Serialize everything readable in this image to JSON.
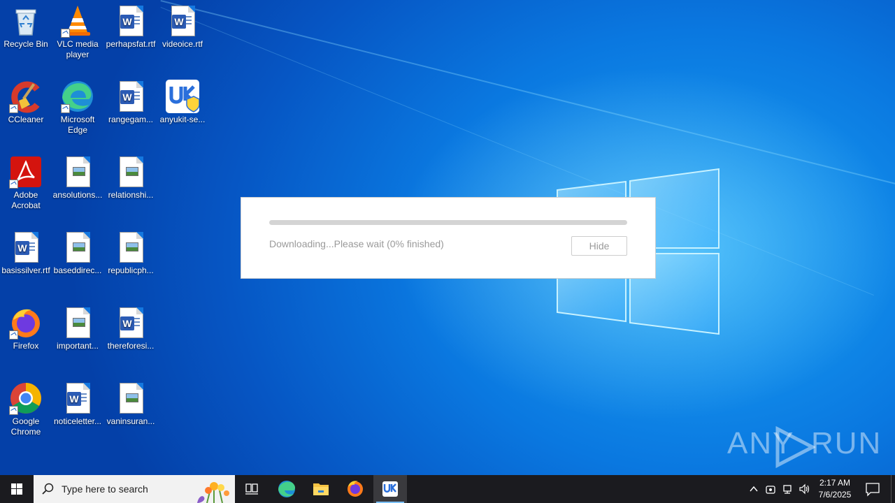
{
  "desktop": {
    "icons": [
      {
        "label": "Recycle Bin"
      },
      {
        "label": "VLC media player"
      },
      {
        "label": "perhapsfat.rtf"
      },
      {
        "label": "videoice.rtf"
      },
      {
        "label": "CCleaner"
      },
      {
        "label": "Microsoft Edge"
      },
      {
        "label": "rangegam..."
      },
      {
        "label": "anyukit-se..."
      },
      {
        "label": "Adobe Acrobat"
      },
      {
        "label": "ansolutions..."
      },
      {
        "label": "relationshi..."
      },
      {
        "label": "basissilver.rtf"
      },
      {
        "label": "baseddirec..."
      },
      {
        "label": "republicph..."
      },
      {
        "label": "Firefox"
      },
      {
        "label": "important..."
      },
      {
        "label": "thereforesi..."
      },
      {
        "label": "Google Chrome"
      },
      {
        "label": "noticeletter..."
      },
      {
        "label": "vaninsuran..."
      }
    ]
  },
  "dialog": {
    "status": "Downloading...Please wait (0% finished)",
    "progress_percent": 0,
    "hide_label": "Hide"
  },
  "watermark": {
    "left": "ANY",
    "right": "RUN"
  },
  "taskbar": {
    "search_placeholder": "Type here to search",
    "time": "2:17 AM",
    "date": "7/6/2025"
  }
}
